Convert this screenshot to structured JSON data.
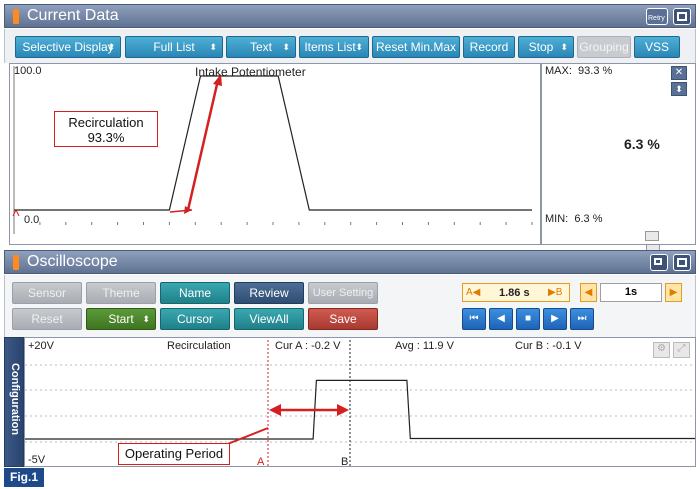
{
  "current_data": {
    "title": "Current Data",
    "retry_label": "Retry",
    "toolbar": [
      {
        "label": "Selective Display",
        "arrow": true
      },
      {
        "label": "Full List",
        "arrow": true
      },
      {
        "label": "Text",
        "arrow": true
      },
      {
        "label": "Items List",
        "arrow": true
      },
      {
        "label": "Reset Min.Max",
        "arrow": false
      },
      {
        "label": "Record",
        "arrow": false
      },
      {
        "label": "Stop",
        "arrow": true
      },
      {
        "label": "Grouping",
        "arrow": false,
        "disabled": true
      },
      {
        "label": "VSS",
        "arrow": false
      }
    ],
    "graph": {
      "ymax_label": "100.0",
      "ymin_label": "0.0",
      "signal_name": "Intake Potentiometer",
      "waveform": [
        [
          0,
          0
        ],
        [
          30,
          0
        ],
        [
          36,
          100
        ],
        [
          51,
          100
        ],
        [
          57,
          0
        ],
        [
          100,
          0
        ]
      ]
    },
    "max_label": "MAX:",
    "max_value": "93.3 %",
    "current_value": "6.3 %",
    "min_label": "MIN:",
    "min_value": "6.3 %",
    "callout_line1": "Recirculation",
    "callout_line2": "93.3%"
  },
  "oscilloscope": {
    "title": "Oscilloscope",
    "buttons_row1": [
      {
        "label": "Sensor",
        "style": "gray"
      },
      {
        "label": "Theme",
        "style": "gray"
      },
      {
        "label": "Name",
        "style": "teal"
      },
      {
        "label": "Review",
        "style": "navy"
      },
      {
        "label": "User Setting",
        "style": "gray"
      }
    ],
    "buttons_row2": [
      {
        "label": "Reset",
        "style": "gray"
      },
      {
        "label": "Start",
        "style": "green"
      },
      {
        "label": "Cursor",
        "style": "teal"
      },
      {
        "label": "ViewAll",
        "style": "teal"
      },
      {
        "label": "Save",
        "style": "red"
      }
    ],
    "cursor_a_marker": "A◀",
    "cursor_time": "1.86 s",
    "cursor_b_marker": "▶B",
    "timebase": "1s",
    "side_tab": "Configuration",
    "scope": {
      "ymax_label": "+20V",
      "ymin_label": "-5V",
      "channel_name": "Recirculation",
      "cur_a": "Cur A : -0.2 V",
      "avg": "Avg : 11.9 V",
      "cur_b": "Cur B : -0.1 V",
      "marker_a": "A",
      "marker_b": "B",
      "waveform": [
        [
          0,
          -0.2
        ],
        [
          43,
          -0.2
        ],
        [
          43.5,
          12
        ],
        [
          57,
          12
        ],
        [
          57.5,
          -0.1
        ],
        [
          100,
          -0.1
        ]
      ]
    },
    "callout": "Operating Period"
  },
  "figure_label": "Fig.1"
}
